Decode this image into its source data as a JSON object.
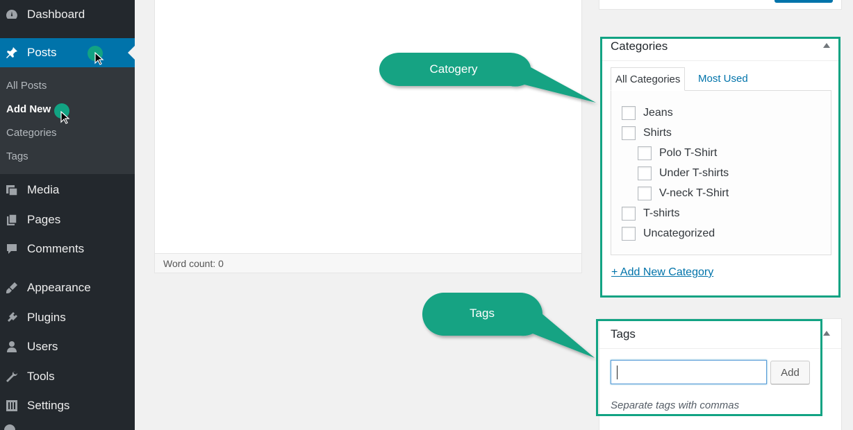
{
  "sidebar": {
    "items": [
      {
        "label": "Dashboard",
        "icon": "dashboard-icon"
      },
      {
        "label": "Posts",
        "icon": "pin-icon"
      },
      {
        "label": "Media",
        "icon": "media-icon"
      },
      {
        "label": "Pages",
        "icon": "pages-icon"
      },
      {
        "label": "Comments",
        "icon": "comments-icon"
      },
      {
        "label": "Appearance",
        "icon": "appearance-icon"
      },
      {
        "label": "Plugins",
        "icon": "plugins-icon"
      },
      {
        "label": "Users",
        "icon": "users-icon"
      },
      {
        "label": "Tools",
        "icon": "tools-icon"
      },
      {
        "label": "Settings",
        "icon": "settings-icon"
      }
    ],
    "posts_submenu": [
      "All Posts",
      "Add New",
      "Categories",
      "Tags"
    ]
  },
  "editor": {
    "word_count": "Word count: 0"
  },
  "categories_box": {
    "title": "Categories",
    "tabs": [
      "All Categories",
      "Most Used"
    ],
    "items": [
      {
        "label": "Jeans",
        "checked": false,
        "child": false
      },
      {
        "label": "Shirts",
        "checked": false,
        "child": false
      },
      {
        "label": "Polo T-Shirt",
        "checked": false,
        "child": true
      },
      {
        "label": "Under T-shirts",
        "checked": false,
        "child": true
      },
      {
        "label": "V-neck T-Shirt",
        "checked": false,
        "child": true
      },
      {
        "label": "T-shirts",
        "checked": false,
        "child": false
      },
      {
        "label": "Uncategorized",
        "checked": false,
        "child": false
      }
    ],
    "add_link": "+ Add New Category"
  },
  "tags_box": {
    "title": "Tags",
    "input_value": "",
    "add_button": "Add",
    "hint": "Separate tags with commas"
  },
  "callouts": {
    "category": "Catogery",
    "tags": "Tags"
  },
  "colors": {
    "sidebar_bg": "#23282d",
    "submenu_bg": "#32373c",
    "active_bg": "#0073aa",
    "accent_green": "#12a383",
    "link": "#0073aa"
  }
}
